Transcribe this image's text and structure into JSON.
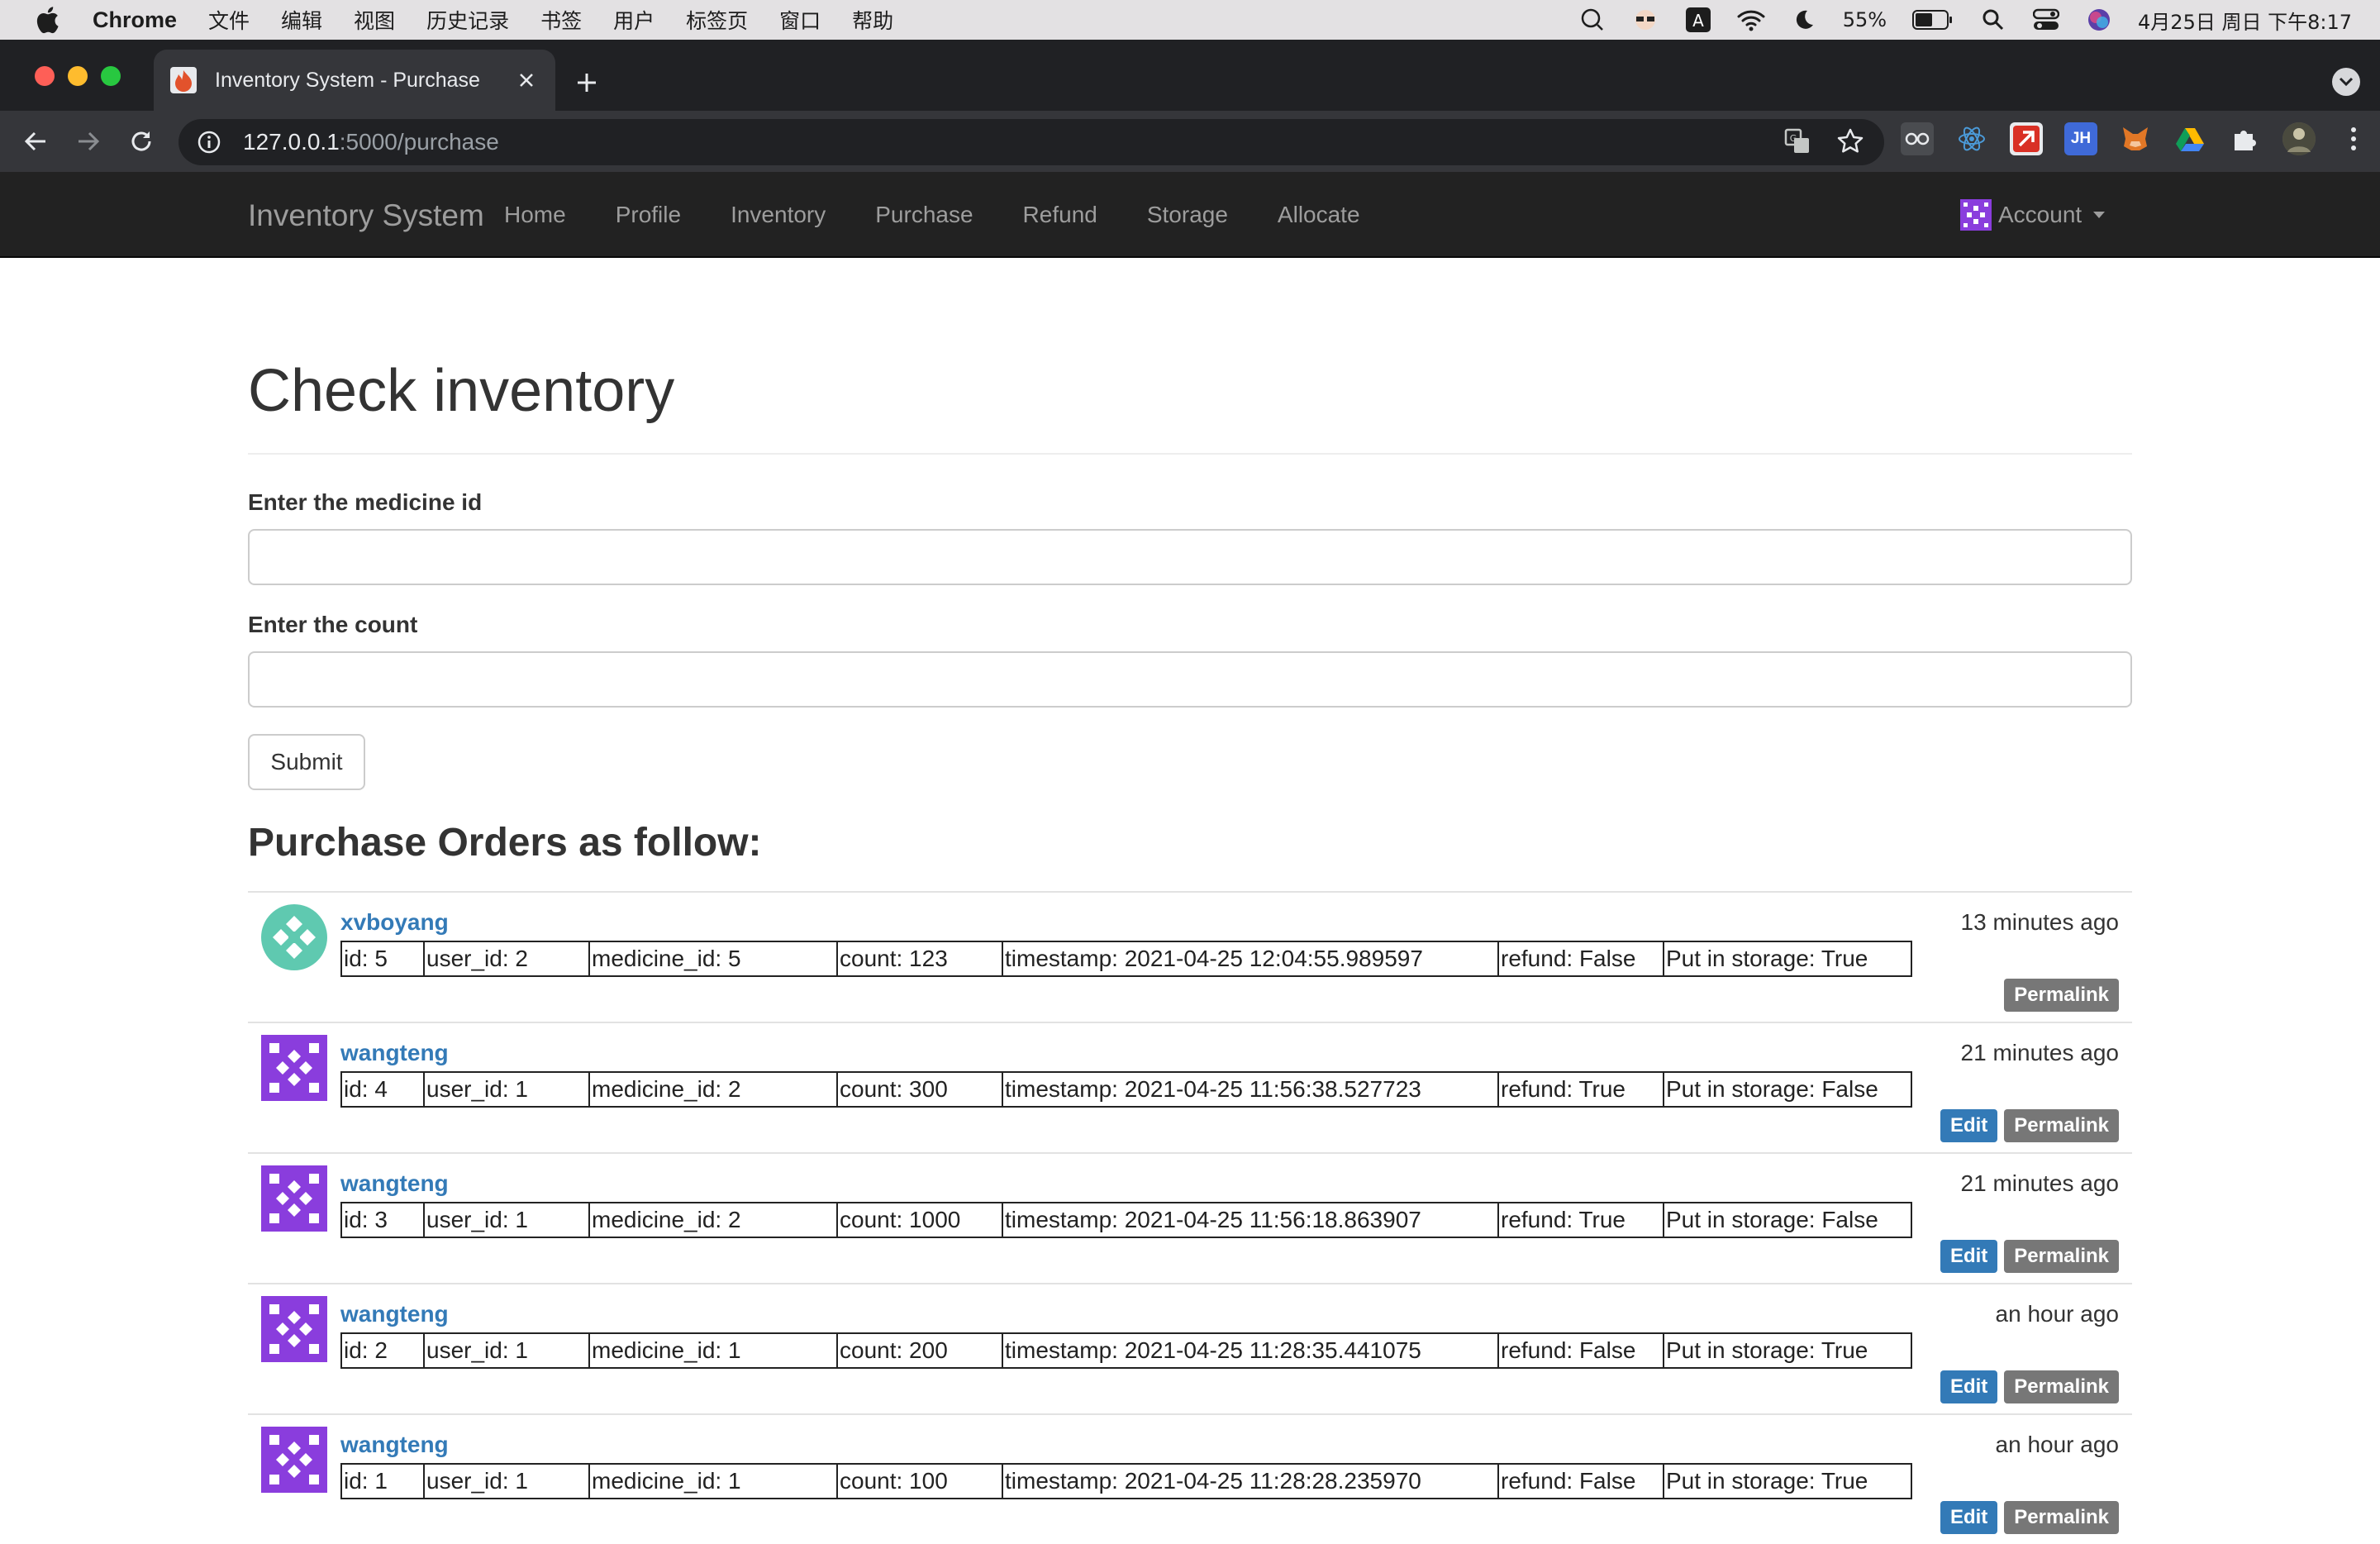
{
  "mac_menubar": {
    "app_name": "Chrome",
    "menus": [
      "文件",
      "编辑",
      "视图",
      "历史记录",
      "书签",
      "用户",
      "标签页",
      "窗口",
      "帮助"
    ],
    "battery": "55%",
    "datetime": "4月25日 周日 下午8:17"
  },
  "browser": {
    "tab_title": "Inventory System - Purchase",
    "url_host": "127.0.0.1",
    "url_path": ":5000/purchase"
  },
  "navbar": {
    "brand": "Inventory System",
    "links": [
      "Home",
      "Profile",
      "Inventory",
      "Purchase",
      "Refund",
      "Storage",
      "Allocate"
    ],
    "account_label": "Account"
  },
  "page": {
    "title": "Check inventory",
    "medicine_label": "Enter the medicine id",
    "medicine_value": "",
    "count_label": "Enter the count",
    "count_value": "",
    "submit_label": "Submit",
    "orders_title": "Purchase Orders as follow:"
  },
  "buttons": {
    "edit": "Edit",
    "permalink": "Permalink"
  },
  "avatar_colors": {
    "xvboyang": "#5fc9b0",
    "wangteng": "#8a3ddd"
  },
  "orders": [
    {
      "user": "xvboyang",
      "time": "13 minutes ago",
      "editable": false,
      "cells": [
        "id: 5",
        "user_id: 2",
        "medicine_id: 5",
        "count: 123",
        "timestamp: 2021-04-25 12:04:55.989597",
        "refund: False",
        "Put in storage: True"
      ]
    },
    {
      "user": "wangteng",
      "time": "21 minutes ago",
      "editable": true,
      "cells": [
        "id: 4",
        "user_id: 1",
        "medicine_id: 2",
        "count: 300",
        "timestamp: 2021-04-25 11:56:38.527723",
        "refund: True",
        "Put in storage: False"
      ]
    },
    {
      "user": "wangteng",
      "time": "21 minutes ago",
      "editable": true,
      "cells": [
        "id: 3",
        "user_id: 1",
        "medicine_id: 2",
        "count: 1000",
        "timestamp: 2021-04-25 11:56:18.863907",
        "refund: True",
        "Put in storage: False"
      ]
    },
    {
      "user": "wangteng",
      "time": "an hour ago",
      "editable": true,
      "cells": [
        "id: 2",
        "user_id: 1",
        "medicine_id: 1",
        "count: 200",
        "timestamp: 2021-04-25 11:28:35.441075",
        "refund: False",
        "Put in storage: True"
      ]
    },
    {
      "user": "wangteng",
      "time": "an hour ago",
      "editable": true,
      "cells": [
        "id: 1",
        "user_id: 1",
        "medicine_id: 1",
        "count: 100",
        "timestamp: 2021-04-25 11:28:28.235970",
        "refund: False",
        "Put in storage: True"
      ]
    }
  ]
}
